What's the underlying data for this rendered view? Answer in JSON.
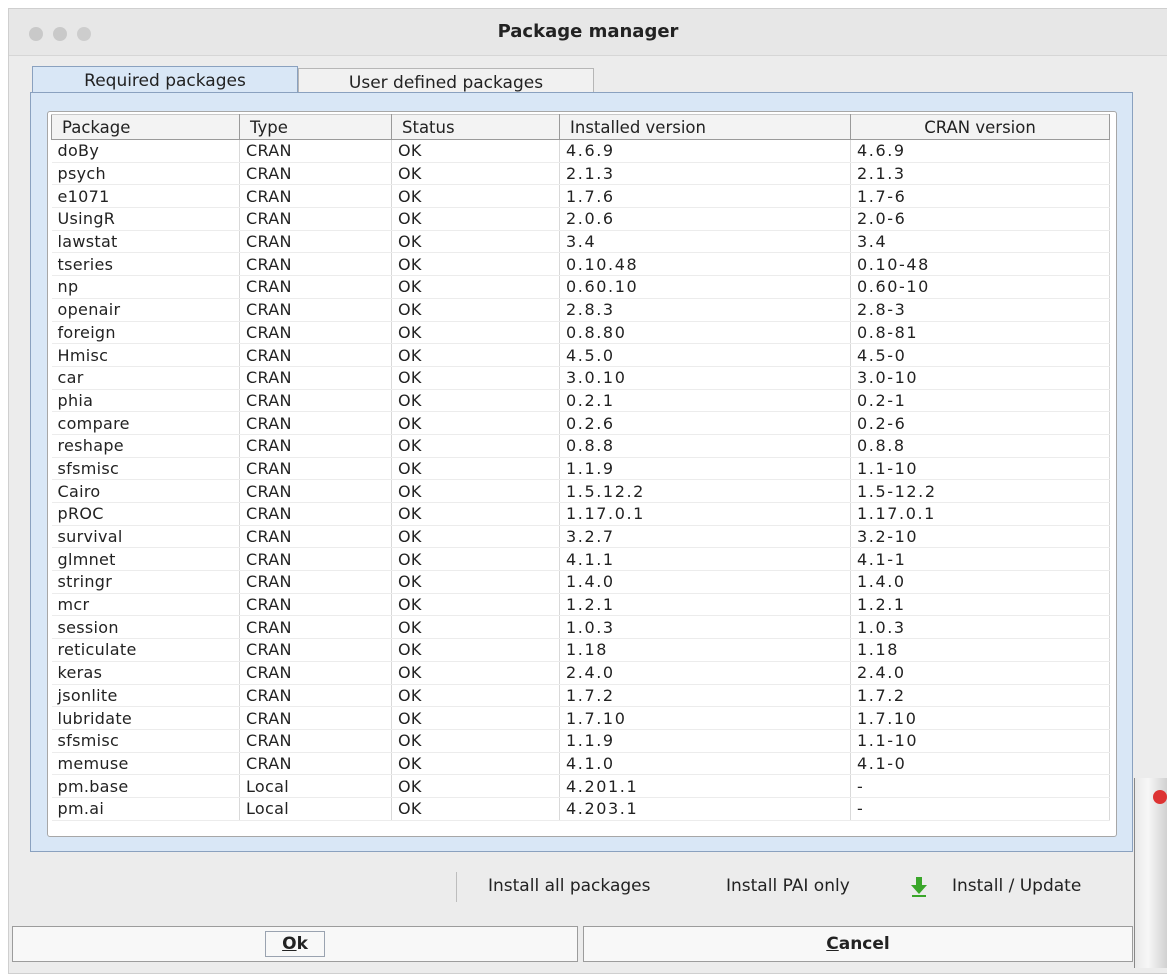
{
  "window": {
    "title": "Package manager"
  },
  "tabs": [
    {
      "label": "Required packages",
      "active": true
    },
    {
      "label": "User defined packages",
      "active": false
    }
  ],
  "table": {
    "columns": [
      "Package",
      "Type",
      "Status",
      "Installed version",
      "CRAN version"
    ],
    "rows": [
      [
        "doBy",
        "CRAN",
        "OK",
        "4.6.9",
        "4.6.9"
      ],
      [
        "psych",
        "CRAN",
        "OK",
        "2.1.3",
        "2.1.3"
      ],
      [
        "e1071",
        "CRAN",
        "OK",
        "1.7.6",
        "1.7-6"
      ],
      [
        "UsingR",
        "CRAN",
        "OK",
        "2.0.6",
        "2.0-6"
      ],
      [
        "lawstat",
        "CRAN",
        "OK",
        "3.4",
        "3.4"
      ],
      [
        "tseries",
        "CRAN",
        "OK",
        "0.10.48",
        "0.10-48"
      ],
      [
        "np",
        "CRAN",
        "OK",
        "0.60.10",
        "0.60-10"
      ],
      [
        "openair",
        "CRAN",
        "OK",
        "2.8.3",
        "2.8-3"
      ],
      [
        "foreign",
        "CRAN",
        "OK",
        "0.8.80",
        "0.8-81"
      ],
      [
        "Hmisc",
        "CRAN",
        "OK",
        "4.5.0",
        "4.5-0"
      ],
      [
        "car",
        "CRAN",
        "OK",
        "3.0.10",
        "3.0-10"
      ],
      [
        "phia",
        "CRAN",
        "OK",
        "0.2.1",
        "0.2-1"
      ],
      [
        "compare",
        "CRAN",
        "OK",
        "0.2.6",
        "0.2-6"
      ],
      [
        "reshape",
        "CRAN",
        "OK",
        "0.8.8",
        "0.8.8"
      ],
      [
        "sfsmisc",
        "CRAN",
        "OK",
        "1.1.9",
        "1.1-10"
      ],
      [
        "Cairo",
        "CRAN",
        "OK",
        "1.5.12.2",
        "1.5-12.2"
      ],
      [
        "pROC",
        "CRAN",
        "OK",
        "1.17.0.1",
        "1.17.0.1"
      ],
      [
        "survival",
        "CRAN",
        "OK",
        "3.2.7",
        "3.2-10"
      ],
      [
        "glmnet",
        "CRAN",
        "OK",
        "4.1.1",
        "4.1-1"
      ],
      [
        "stringr",
        "CRAN",
        "OK",
        "1.4.0",
        "1.4.0"
      ],
      [
        "mcr",
        "CRAN",
        "OK",
        "1.2.1",
        "1.2.1"
      ],
      [
        "session",
        "CRAN",
        "OK",
        "1.0.3",
        "1.0.3"
      ],
      [
        "reticulate",
        "CRAN",
        "OK",
        "1.18",
        "1.18"
      ],
      [
        "keras",
        "CRAN",
        "OK",
        "2.4.0",
        "2.4.0"
      ],
      [
        "jsonlite",
        "CRAN",
        "OK",
        "1.7.2",
        "1.7.2"
      ],
      [
        "lubridate",
        "CRAN",
        "OK",
        "1.7.10",
        "1.7.10"
      ],
      [
        "sfsmisc",
        "CRAN",
        "OK",
        "1.1.9",
        "1.1-10"
      ],
      [
        "memuse",
        "CRAN",
        "OK",
        "4.1.0",
        "4.1-0"
      ],
      [
        "pm.base",
        "Local",
        "OK",
        "4.201.1",
        "-"
      ],
      [
        "pm.ai",
        "Local",
        "OK",
        "4.203.1",
        "-"
      ]
    ]
  },
  "actions": {
    "install_all": "Install all packages",
    "install_pai": "Install PAI only",
    "install_update": "Install / Update",
    "install_update_icon": "download-arrow-icon"
  },
  "buttons": {
    "ok_underline": "O",
    "ok_rest": "k",
    "cancel_underline": "C",
    "cancel_rest": "ancel"
  },
  "colors": {
    "tab_active": "#d9e7f6",
    "tab_border": "#8aa1bf",
    "icon_green": "#3aa62a"
  }
}
